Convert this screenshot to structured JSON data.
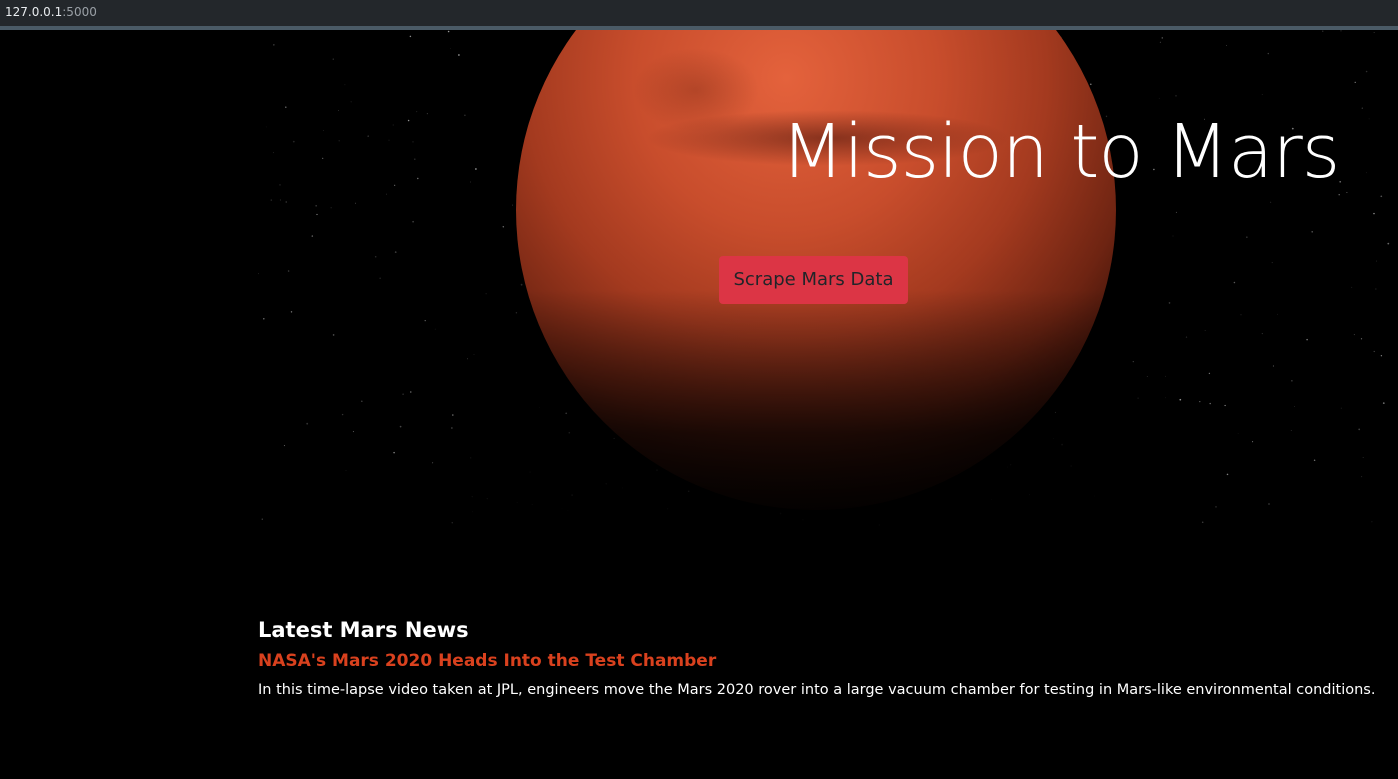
{
  "browser": {
    "address_host": "127.0.0.1",
    "address_port": ":5000"
  },
  "hero": {
    "title": "Mission to Mars",
    "button_label": "Scrape Mars Data",
    "button_color": "#dc3545"
  },
  "news": {
    "heading": "Latest Mars News",
    "title": "NASA's Mars 2020 Heads Into the Test Chamber",
    "paragraph": "In this time-lapse video taken at JPL, engineers move the Mars 2020 rover into a large vacuum chamber for testing in Mars-like environmental conditions.",
    "title_color": "#d9411e"
  }
}
